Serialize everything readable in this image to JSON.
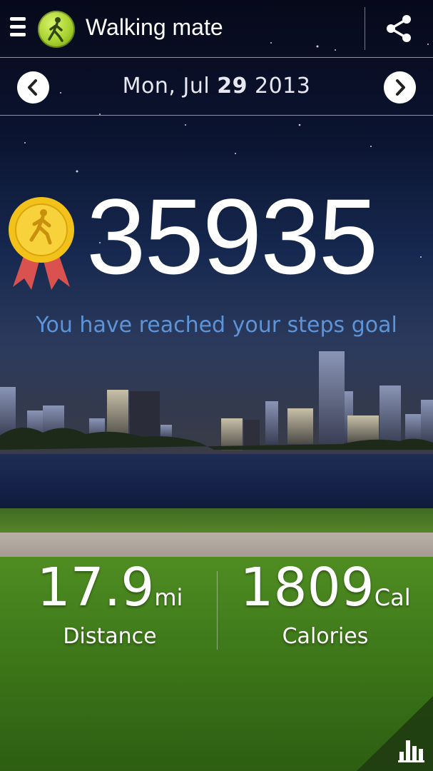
{
  "header": {
    "menu_icon": "menu-icon",
    "app_icon": "walker-icon",
    "title": "Walking mate",
    "share_icon": "share-icon"
  },
  "datebar": {
    "prev_icon": "chevron-left-icon",
    "date_prefix": "Mon, Jul ",
    "date_day": "29",
    "date_year": " 2013",
    "next_icon": "chevron-right-icon"
  },
  "main": {
    "medal_icon": "medal-icon",
    "steps": "35935",
    "goal_message": "You have reached your steps goal"
  },
  "stats": {
    "distance": {
      "value": "17.9",
      "unit": "mi",
      "label": "Distance"
    },
    "calories": {
      "value": "1809",
      "unit": "Cal",
      "label": "Calories"
    }
  },
  "footer": {
    "chart_icon": "bar-chart-icon"
  },
  "colors": {
    "goal_text": "#5d94d9",
    "medal_gold": "#f2c21a",
    "ribbon": "#d9524f"
  }
}
